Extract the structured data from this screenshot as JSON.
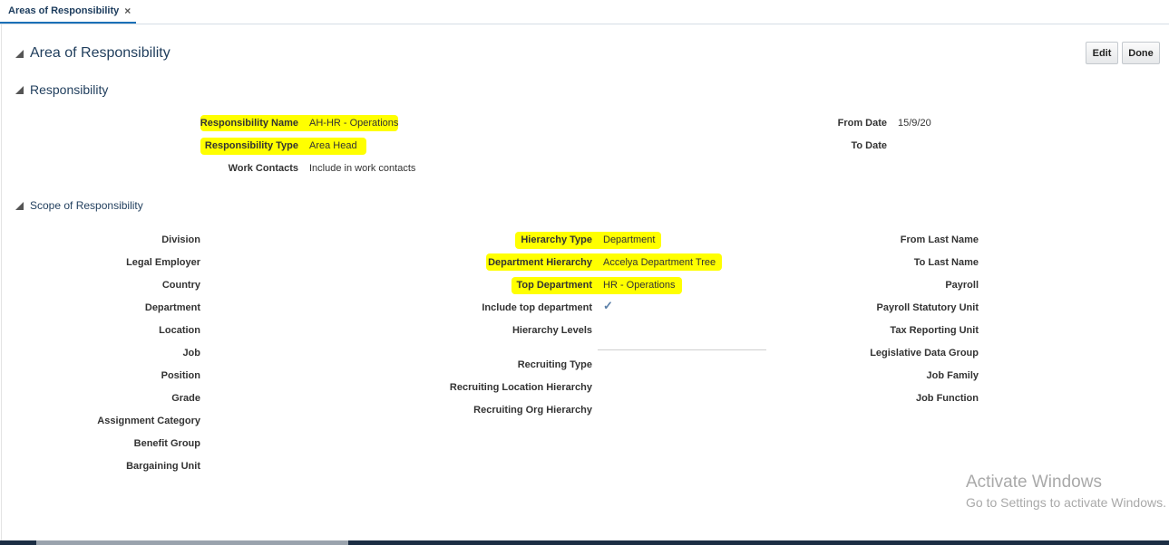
{
  "tab": {
    "label": "Areas of Responsibility",
    "close": "×"
  },
  "page": {
    "title": "Area of Responsibility",
    "buttons": {
      "edit": "Edit",
      "done": "Done"
    }
  },
  "responsibility": {
    "heading": "Responsibility",
    "name_label": "Responsibility Name",
    "name_value": "AH-HR - Operations",
    "type_label": "Responsibility Type",
    "type_value": "Area Head",
    "contacts_label": "Work Contacts",
    "contacts_value": "Include in work contacts",
    "from_date_label": "From Date",
    "from_date_value": "15/9/20",
    "to_date_label": "To Date",
    "to_date_value": ""
  },
  "scope": {
    "heading": "Scope of Responsibility",
    "left_labels": [
      "Division",
      "Legal Employer",
      "Country",
      "Department",
      "Location",
      "Job",
      "Position",
      "Grade",
      "Assignment Category",
      "Benefit Group",
      "Bargaining Unit"
    ],
    "hierarchy_type_label": "Hierarchy Type",
    "hierarchy_type_value": "Department",
    "department_hierarchy_label": "Department Hierarchy",
    "department_hierarchy_value": "Accelya Department Tree",
    "top_department_label": "Top Department",
    "top_department_value": "HR - Operations",
    "include_top_label": "Include top department",
    "include_top_checked": true,
    "hierarchy_levels_label": "Hierarchy Levels",
    "recruiting_type_label": "Recruiting Type",
    "recruiting_location_label": "Recruiting Location Hierarchy",
    "recruiting_org_label": "Recruiting Org Hierarchy",
    "right_labels": [
      "From Last Name",
      "To Last Name",
      "Payroll",
      "Payroll Statutory Unit",
      "Tax Reporting Unit",
      "Legislative Data Group",
      "Job Family",
      "Job Function"
    ]
  },
  "watermark": {
    "line1": "Activate Windows",
    "line2": "Go to Settings to activate Windows."
  },
  "colors": {
    "highlight": "#ffff00",
    "heading": "#1f3d5c",
    "tab_underline": "#1a70b7"
  }
}
